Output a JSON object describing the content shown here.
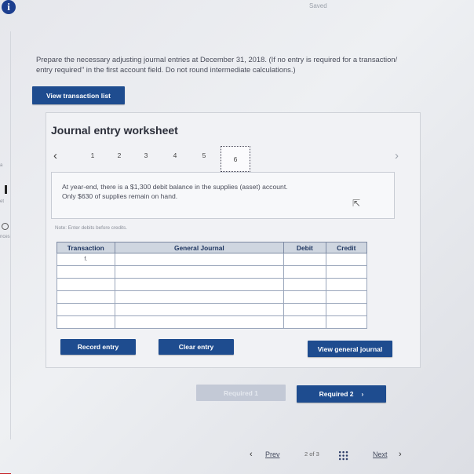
{
  "header": {
    "info_glyph": "i",
    "status": "Saved"
  },
  "instructions": {
    "line1": "Prepare the necessary adjusting journal entries at December 31, 2018. (If no entry is required for a transaction/",
    "line2": "entry required\" in the first account field. Do not round intermediate calculations.)"
  },
  "view_transaction_list": "View transaction list",
  "worksheet": {
    "title": "Journal entry worksheet",
    "pager": {
      "prev": "‹",
      "pages": [
        "1",
        "2",
        "3",
        "4",
        "5"
      ],
      "active_page": "6",
      "next": "›"
    },
    "question_line1": "At year-end, there is a $1,300 debit balance in the supplies (asset) account.",
    "question_line2": "Only $630 of supplies remain on hand.",
    "note": "Note: Enter debits before credits.",
    "table": {
      "headers": {
        "transaction": "Transaction",
        "account": "General Journal",
        "debit": "Debit",
        "credit": "Credit"
      },
      "rows": [
        {
          "transaction": "f.",
          "account": "",
          "debit": "",
          "credit": ""
        },
        {
          "transaction": "",
          "account": "",
          "debit": "",
          "credit": ""
        },
        {
          "transaction": "",
          "account": "",
          "debit": "",
          "credit": ""
        },
        {
          "transaction": "",
          "account": "",
          "debit": "",
          "credit": ""
        },
        {
          "transaction": "",
          "account": "",
          "debit": "",
          "credit": ""
        },
        {
          "transaction": "",
          "account": "",
          "debit": "",
          "credit": ""
        }
      ]
    },
    "buttons": {
      "record": "Record entry",
      "clear": "Clear entry",
      "view_general": "View general journal"
    }
  },
  "required_nav": {
    "prev_required": "Required 1",
    "next_required": "Required 2",
    "next_glyph": "›"
  },
  "bottom_nav": {
    "prev_glyph": "‹",
    "prev": "Prev",
    "page_current": "2",
    "page_of": "of",
    "page_total": "3",
    "next": "Next",
    "next_glyph": "›"
  },
  "colors": {
    "primary_button": "#1e4c8f",
    "disabled_button": "#c3c9d6",
    "table_header": "#cfd6e0",
    "brand_logo": "#c62026"
  }
}
